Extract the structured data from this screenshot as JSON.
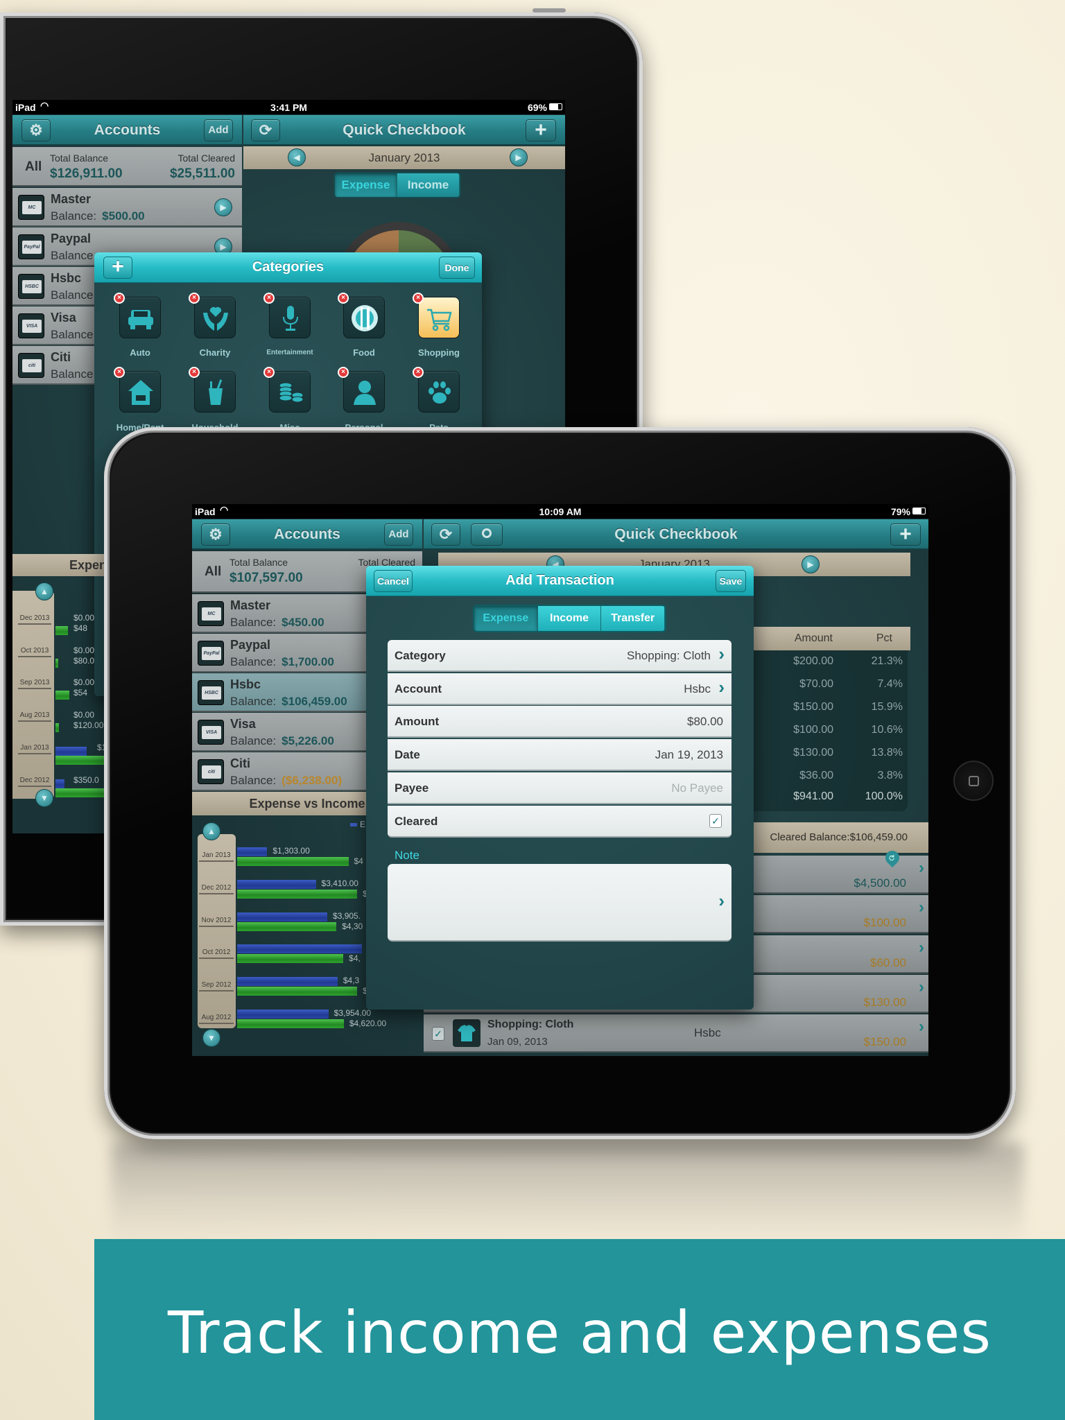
{
  "banner": {
    "text": "Track income and expenses"
  },
  "colors": {
    "nav_teal": "#267d84",
    "modal_cyan": "#27bcc6",
    "banner": "#22949a",
    "expense_bar": "#2a48a8",
    "income_bar": "#2ea22e",
    "negative": "#b8862c"
  },
  "back_ipad": {
    "status": {
      "device": "iPad",
      "time": "3:41 PM",
      "battery": "69%"
    },
    "accounts_nav": {
      "title": "Accounts",
      "add": "Add"
    },
    "main_nav": {
      "title": "Quick Checkbook"
    },
    "summary": {
      "all": "All",
      "total_balance_label": "Total Balance",
      "total_balance": "$126,911.00",
      "total_cleared_label": "Total Cleared",
      "total_cleared": "$25,511.00"
    },
    "accounts": [
      {
        "name": "Master",
        "balance_label": "Balance:",
        "balance": "$500.00",
        "icon": "mastercard-icon",
        "card": "MC"
      },
      {
        "name": "Paypal",
        "balance_label": "Balance",
        "balance": "",
        "icon": "paypal-icon",
        "card": "PayPal"
      },
      {
        "name": "Hsbc",
        "balance_label": "Balance",
        "balance": "",
        "icon": "hsbc-icon",
        "card": "HSBC"
      },
      {
        "name": "Visa",
        "balance_label": "Balance",
        "balance": "",
        "icon": "visa-icon",
        "card": "VISA"
      },
      {
        "name": "Citi",
        "balance_label": "Balance",
        "balance": "",
        "icon": "citibank-icon",
        "card": "citi"
      }
    ],
    "month": "January 2013",
    "segments": [
      {
        "label": "Expense",
        "active": true
      },
      {
        "label": "Income",
        "active": false
      }
    ],
    "categories_modal": {
      "title": "Categories",
      "done": "Done",
      "items": [
        {
          "label": "Auto",
          "icon": "car-icon",
          "selected": false
        },
        {
          "label": "Charity",
          "icon": "heart-hands-icon",
          "selected": false
        },
        {
          "label": "Entertainment",
          "icon": "microphone-icon",
          "selected": false
        },
        {
          "label": "Food",
          "icon": "plate-cutlery-icon",
          "selected": false
        },
        {
          "label": "Shopping",
          "icon": "shopping-cart-icon",
          "selected": true
        },
        {
          "label": "Home/Rent",
          "icon": "house-icon",
          "selected": false
        },
        {
          "label": "Household",
          "icon": "toothbrush-cup-icon",
          "selected": false
        },
        {
          "label": "Misc",
          "icon": "coins-icon",
          "selected": false
        },
        {
          "label": "Personal",
          "icon": "person-icon",
          "selected": false
        },
        {
          "label": "Pets",
          "icon": "paw-icon",
          "selected": false
        }
      ]
    },
    "chart": {
      "header": "Expense vs Income",
      "rows": [
        {
          "month": "Dec 2013",
          "expense_label": "$0.00",
          "income_label": "$48"
        },
        {
          "month": "Oct 2013",
          "expense_label": "$0.00",
          "income_label": "$80.0"
        },
        {
          "month": "Sep 2013",
          "expense_label": "$0.00",
          "income_label": "$54"
        },
        {
          "month": "Aug 2013",
          "expense_label": "$0.00",
          "income_label": "$120.00"
        },
        {
          "month": "Jan 2013",
          "expense_label": "$1",
          "income_label": ""
        },
        {
          "month": "Dec 2012",
          "expense_label": "$350.0",
          "income_label": ""
        }
      ]
    }
  },
  "front_ipad": {
    "status": {
      "device": "iPad",
      "time": "10:09 AM",
      "battery": "79%"
    },
    "accounts_nav": {
      "title": "Accounts",
      "add": "Add"
    },
    "main_nav": {
      "title": "Quick Checkbook"
    },
    "summary": {
      "all": "All",
      "total_balance_label": "Total Balance",
      "total_balance": "$107,597.00",
      "total_cleared_label": "Total Cleared"
    },
    "accounts": [
      {
        "name": "Master",
        "balance_label": "Balance:",
        "balance": "$450.00",
        "icon": "mastercard-icon",
        "card": "MC",
        "selected": false,
        "negative": false
      },
      {
        "name": "Paypal",
        "balance_label": "Balance:",
        "balance": "$1,700.00",
        "icon": "paypal-icon",
        "card": "PayPal",
        "selected": false,
        "negative": false
      },
      {
        "name": "Hsbc",
        "balance_label": "Balance:",
        "balance": "$106,459.00",
        "icon": "hsbc-icon",
        "card": "HSBC",
        "selected": true,
        "negative": false
      },
      {
        "name": "Visa",
        "balance_label": "Balance:",
        "balance": "$5,226.00",
        "icon": "visa-icon",
        "card": "VISA",
        "selected": false,
        "negative": false
      },
      {
        "name": "Citi",
        "balance_label": "Balance:",
        "balance": "($6,238.00)",
        "icon": "citibank-icon",
        "card": "citi",
        "selected": false,
        "negative": true
      }
    ],
    "month": "January 2013",
    "category_table": {
      "headers": [
        "Amount",
        "Pct"
      ],
      "rows": [
        [
          "$200.00",
          "21.3%"
        ],
        [
          "$70.00",
          "7.4%"
        ],
        [
          "$150.00",
          "15.9%"
        ],
        [
          "$100.00",
          "10.6%"
        ],
        [
          "$130.00",
          "13.8%"
        ],
        [
          "$36.00",
          "3.8%"
        ]
      ],
      "total": [
        "$941.00",
        "100.0%"
      ]
    },
    "cleared_balance": "Cleared Balance:$106,459.00",
    "transactions": [
      {
        "amount": "$4,500.00",
        "type": "income"
      },
      {
        "amount": "$100.00",
        "type": "expense"
      },
      {
        "amount": "$60.00",
        "type": "expense"
      },
      {
        "amount": "$130.00",
        "type": "expense"
      },
      {
        "amount": "$150.00",
        "type": "expense",
        "category": "Shopping: Cloth",
        "date": "Jan 09, 2013",
        "account": "Hsbc",
        "cleared": true
      }
    ],
    "chart_data": {
      "type": "bar",
      "orientation": "horizontal",
      "title": "Expense vs Income",
      "legend": [
        "E"
      ],
      "categories": [
        "Jan 2013",
        "Dec 2012",
        "Nov 2012",
        "Oct 2012",
        "Sep 2012",
        "Aug 2012"
      ],
      "series": [
        {
          "name": "E",
          "color": "#2a48a8",
          "values": [
            1303,
            3410,
            3905,
            5400,
            4350,
            3954
          ],
          "labels": [
            "$1,303.00",
            "$3,410.00",
            "$3,905.",
            "",
            "$4,3",
            "$3,954.00"
          ]
        },
        {
          "color": "#2ea22e",
          "values": [
            4820,
            5200,
            4300,
            4600,
            5200,
            4620
          ],
          "labels": [
            "$4",
            "$",
            "$4,30",
            "$4,",
            "$",
            "$4,620.00"
          ]
        }
      ]
    },
    "add_transaction": {
      "cancel": "Cancel",
      "title": "Add Transaction",
      "save": "Save",
      "segments": [
        {
          "label": "Expense",
          "active": true
        },
        {
          "label": "Income",
          "active": false
        },
        {
          "label": "Transfer",
          "active": false
        }
      ],
      "fields": [
        {
          "label": "Category",
          "value": "Shopping: Cloth",
          "chevron": true
        },
        {
          "label": "Account",
          "value": "Hsbc",
          "chevron": true
        },
        {
          "label": "Amount",
          "value": "$80.00",
          "chevron": false
        },
        {
          "label": "Date",
          "value": "Jan 19, 2013",
          "chevron": false
        },
        {
          "label": "Payee",
          "placeholder": "No Payee",
          "chevron": false
        },
        {
          "label": "Cleared",
          "checked": true
        }
      ],
      "note_label": "Note",
      "note_value": ""
    }
  }
}
